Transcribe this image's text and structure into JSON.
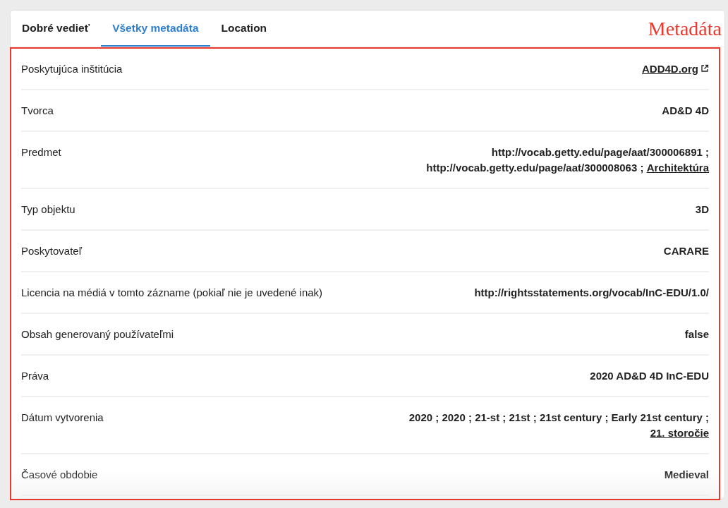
{
  "tabs": [
    {
      "label": "Dobré vedieť",
      "selected": false
    },
    {
      "label": "Všetky metadáta",
      "selected": true
    },
    {
      "label": "Location",
      "selected": false
    }
  ],
  "annotation": {
    "label": "Metadáta"
  },
  "metadata": [
    {
      "label": "Poskytujúca inštitúcia",
      "values": [
        {
          "text": "ADD4D.org",
          "kind": "external-link"
        }
      ]
    },
    {
      "label": "Tvorca",
      "values": [
        {
          "text": "AD&D 4D",
          "kind": "strong"
        }
      ]
    },
    {
      "label": "Predmet",
      "values": [
        {
          "text": "http://vocab.getty.edu/page/aat/300006891 ;",
          "kind": "plain"
        },
        {
          "text": "http://vocab.getty.edu/page/aat/300008063 ;",
          "kind": "plain"
        },
        {
          "text": "Architektúra",
          "kind": "link"
        }
      ]
    },
    {
      "label": "Typ objektu",
      "values": [
        {
          "text": "3D",
          "kind": "strong"
        }
      ]
    },
    {
      "label": "Poskytovateľ",
      "values": [
        {
          "text": "CARARE",
          "kind": "strong"
        }
      ]
    },
    {
      "label": "Licencia na médiá v tomto zázname (pokiaľ nie je uvedené inak)",
      "values": [
        {
          "text": "http://rightsstatements.org/vocab/InC-EDU/1.0/",
          "kind": "strong"
        }
      ]
    },
    {
      "label": "Obsah generovaný používateľmi",
      "values": [
        {
          "text": "false",
          "kind": "strong"
        }
      ]
    },
    {
      "label": "Práva",
      "values": [
        {
          "text": "2020 AD&D 4D InC-EDU",
          "kind": "strong"
        }
      ]
    },
    {
      "label": "Dátum vytvorenia",
      "values": [
        {
          "text": "2020 ;",
          "kind": "strong"
        },
        {
          "text": "2020 ;",
          "kind": "strong"
        },
        {
          "text": "21-st ;",
          "kind": "strong"
        },
        {
          "text": "21st ;",
          "kind": "strong"
        },
        {
          "text": "21st century ;",
          "kind": "strong"
        },
        {
          "text": "Early 21st century ;",
          "kind": "strong"
        },
        {
          "text": "21. storočie",
          "kind": "link"
        }
      ]
    },
    {
      "label": "Časové obdobie",
      "values": [
        {
          "text": "Medieval",
          "kind": "strong"
        }
      ]
    }
  ]
}
